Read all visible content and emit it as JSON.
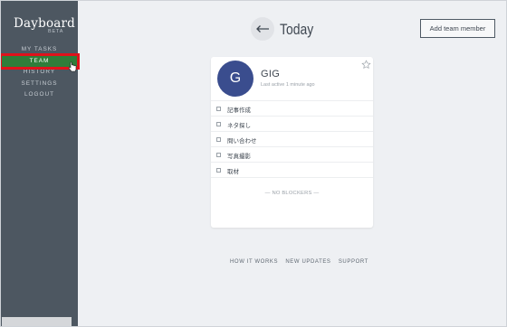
{
  "app": {
    "logo": "Dayboard",
    "badge": "BETA"
  },
  "sidebar": {
    "items": [
      {
        "label": "MY TASKS",
        "active": false
      },
      {
        "label": "TEAM",
        "active": true
      },
      {
        "label": "HISTORY",
        "active": false
      },
      {
        "label": "SETTINGS",
        "active": false
      },
      {
        "label": "LOGOUT",
        "active": false
      }
    ]
  },
  "header": {
    "title": "Today",
    "add_button": "Add team member"
  },
  "card": {
    "avatar_letter": "G",
    "name": "GIG",
    "last_active": "Last active 1 minute ago",
    "tasks": [
      {
        "label": "記事作成",
        "checked": false
      },
      {
        "label": "ネタ探し",
        "checked": false
      },
      {
        "label": "問い合わせ",
        "checked": false
      },
      {
        "label": "写真撮影",
        "checked": false
      },
      {
        "label": "取材",
        "checked": false
      }
    ],
    "blockers": "— NO BLOCKERS —"
  },
  "footer": {
    "links": [
      "HOW IT WORKS",
      "NEW UPDATES",
      "SUPPORT"
    ]
  },
  "colors": {
    "sidebar_bg": "#4d5761",
    "active_bg": "#2f7d3a",
    "highlight_border": "#e0121b",
    "avatar_bg": "#3a4d8e",
    "page_bg": "#eef0f3"
  }
}
